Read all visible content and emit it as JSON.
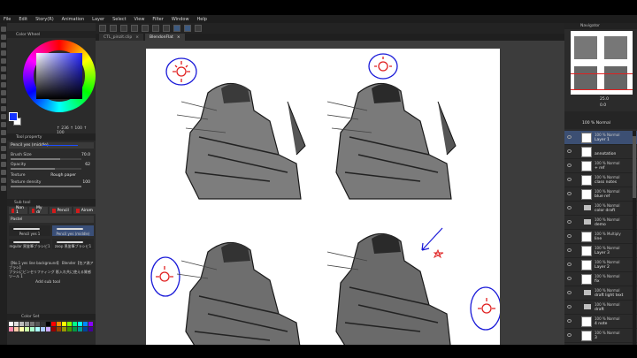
{
  "menu": [
    "File",
    "Edit",
    "Story(R)",
    "Animation",
    "Layer",
    "Select",
    "View",
    "Filter",
    "Window",
    "Help"
  ],
  "tabs": [
    {
      "label": "CTL_pinzit.clip",
      "active": false
    },
    {
      "label": "BlendonFlat",
      "active": true
    }
  ],
  "color_wheel": {
    "title": "Color Wheel",
    "main_color": "#1433ff",
    "sub_color": "#ffffff",
    "hsv": "↑ 236  ↑ 100  ↑ 100"
  },
  "tool_property": {
    "title": "Tool property",
    "preset": "Pencil yes (middle)",
    "brush_size_label": "Brush Size",
    "brush_size_value": "70.0",
    "opacity_label": "Opacity",
    "opacity_value": "62",
    "texture_label": "Texture",
    "texture_value": "Rough paper",
    "texture_density_label": "Texture density",
    "texture_density_value": "100",
    "brush_size_level": 0.7,
    "opacity_level": 0.62,
    "density_level": 1.0
  },
  "sub_tool": {
    "title": "Sub tool",
    "groups": [
      "Non 1",
      "My dr",
      "Pencil",
      "Airom"
    ],
    "active_tool": "Pastel",
    "brushes": [
      {
        "label": "Pencil yes 1",
        "selected": false
      },
      {
        "label": "Pencil yes (middle)",
        "selected": true
      },
      {
        "label": "regular 黒鉴筆ブラシビ1",
        "selected": false
      },
      {
        "label": "zoop 黒鉴筆ブラシビ1",
        "selected": false
      }
    ],
    "line_a": "【No.1 yes line background】 Blender【包ア満アブラシ】",
    "line_b": "ブラシにビンセリフティング  影入れ共に使える質感ツール 1",
    "add_label": "Add sub tool"
  },
  "color_set": {
    "title": "Color Set",
    "swatches": [
      "#ffffff",
      "#dddddd",
      "#bbbbbb",
      "#999999",
      "#777777",
      "#555555",
      "#333333",
      "#000000",
      "#ff0000",
      "#ff8800",
      "#ffff00",
      "#88ff00",
      "#00ff88",
      "#00ffff",
      "#0088ff",
      "#8800ff",
      "#ff88aa",
      "#ffccaa",
      "#ffffaa",
      "#ccffaa",
      "#aaffcc",
      "#aaffff",
      "#aaccff",
      "#ccaaff",
      "#990000",
      "#994400",
      "#999900",
      "#449900",
      "#009944",
      "#009999",
      "#004499",
      "#440099"
    ]
  },
  "navigator": {
    "title": "Navigator",
    "zoom": "25.0",
    "angle": "0.0"
  },
  "layer_panel": {
    "blend": "100 %  Normal",
    "layers": [
      {
        "opacity": "100 % Normal",
        "name": "Layer 1",
        "type": "layer",
        "selected": true
      },
      {
        "opacity": "",
        "name": "annotation",
        "type": "layer",
        "selected": false
      },
      {
        "opacity": "100 % Normal",
        "name": "+ ref",
        "type": "layer",
        "selected": false
      },
      {
        "opacity": "100 % Normal",
        "name": "class notes",
        "type": "layer",
        "selected": false
      },
      {
        "opacity": "100 % Normal",
        "name": "blue ref",
        "type": "layer",
        "selected": false
      },
      {
        "opacity": "100 % Normal",
        "name": "color draft",
        "type": "folder",
        "selected": false
      },
      {
        "opacity": "100 % Normal",
        "name": "demo",
        "type": "folder",
        "selected": false
      },
      {
        "opacity": "100 % Multiply",
        "name": "line",
        "type": "layer",
        "selected": false
      },
      {
        "opacity": "100 % Normal",
        "name": "Layer 3",
        "type": "layer",
        "selected": false
      },
      {
        "opacity": "100 % Normal",
        "name": "Layer 2",
        "type": "layer",
        "selected": false
      },
      {
        "opacity": "100 % Normal",
        "name": "fix",
        "type": "layer",
        "selected": false
      },
      {
        "opacity": "100 % Normal",
        "name": "draft light text",
        "type": "folder",
        "selected": false
      },
      {
        "opacity": "100 % Normal",
        "name": "draft",
        "type": "folder",
        "selected": false
      },
      {
        "opacity": "100 % Normal",
        "name": "4 note",
        "type": "layer",
        "selected": false
      },
      {
        "opacity": "100 % Normal",
        "name": "3",
        "type": "layer",
        "selected": false
      }
    ]
  },
  "accent_color": "#3c4f73"
}
